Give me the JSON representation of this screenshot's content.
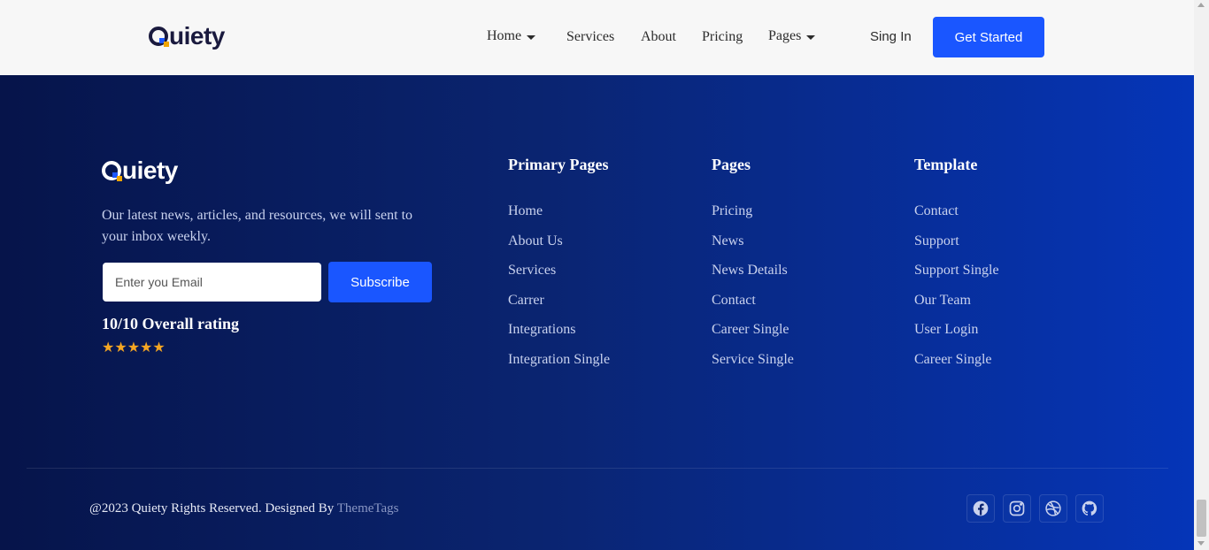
{
  "header": {
    "logo_text": "uiety",
    "nav": [
      {
        "label": "Home",
        "dropdown": true
      },
      {
        "label": "Services",
        "dropdown": false
      },
      {
        "label": "About",
        "dropdown": false
      },
      {
        "label": "Pricing",
        "dropdown": false
      },
      {
        "label": "Pages",
        "dropdown": true
      }
    ],
    "signin_label": "Sing In",
    "cta_label": "Get Started"
  },
  "footer": {
    "logo_text": "uiety",
    "tagline": "Our latest news, articles, and resources, we will sent to your inbox weekly.",
    "email_placeholder": "Enter you Email",
    "subscribe_label": "Subscribe",
    "rating_text": "10/10 Overall rating",
    "stars": 5,
    "columns": [
      {
        "title": "Primary Pages",
        "links": [
          "Home",
          "About Us",
          "Services",
          "Carrer",
          "Integrations",
          "Integration Single"
        ]
      },
      {
        "title": "Pages",
        "links": [
          "Pricing",
          "News",
          "News Details",
          "Contact",
          "Career Single",
          "Service Single"
        ]
      },
      {
        "title": "Template",
        "links": [
          "Contact",
          "Support",
          "Support Single",
          "Our Team",
          "User Login",
          "Career Single"
        ]
      }
    ],
    "copyright_text": "@2023 Quiety Rights Reserved. Designed By ",
    "copyright_brand": "ThemeTags",
    "socials": [
      "facebook-icon",
      "instagram-icon",
      "dribbble-icon",
      "github-icon"
    ]
  },
  "colors": {
    "accent": "#1a56ff",
    "footer_start": "#06144a",
    "footer_end": "#0535b8",
    "star": "#f5a623"
  }
}
